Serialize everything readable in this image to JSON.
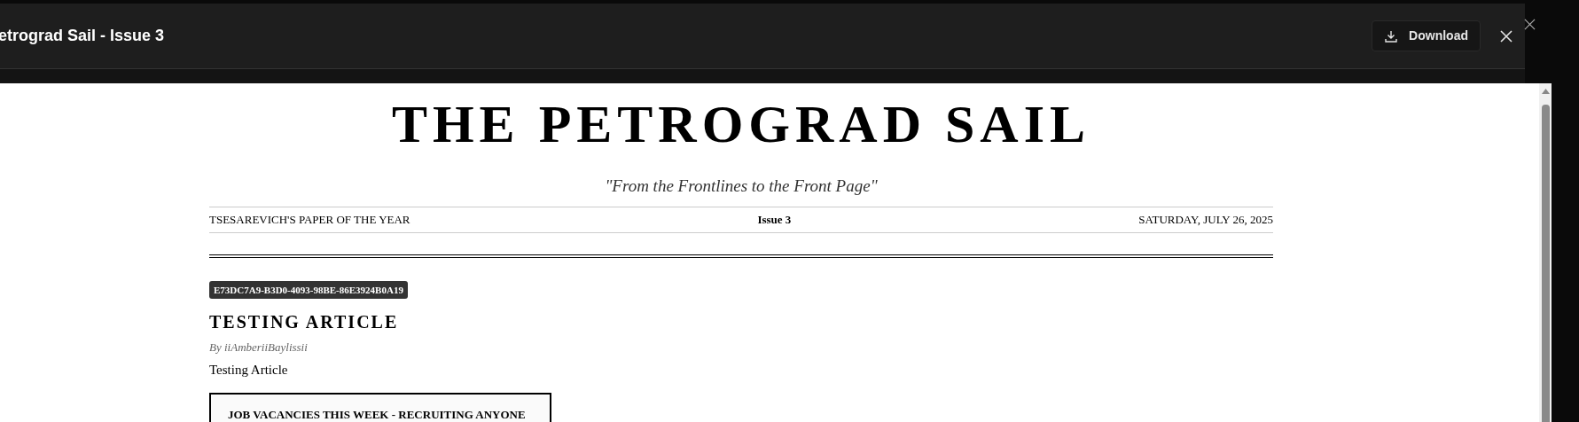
{
  "dialog": {
    "title": "etrograd Sail - Issue 3",
    "download_button": "Download"
  },
  "newspaper": {
    "masthead": "THE PETROGRAD SAIL",
    "tagline": "\"From the Frontlines to the Front Page\"",
    "info_bar": {
      "left": "TSESAREVICH'S PAPER OF THE YEAR",
      "center": "Issue 3",
      "right": "SATURDAY, JULY 26, 2025"
    },
    "article": {
      "id_badge": "E73DC7A9-B3D0-4093-98BE-86E3924B0A19",
      "headline": "TESTING ARTICLE",
      "byline": "By iiAmberiiBaylissii",
      "body": "Testing Article"
    },
    "box_heading": "JOB VACANCIES THIS WEEK - RECRUITING ANYONE"
  }
}
